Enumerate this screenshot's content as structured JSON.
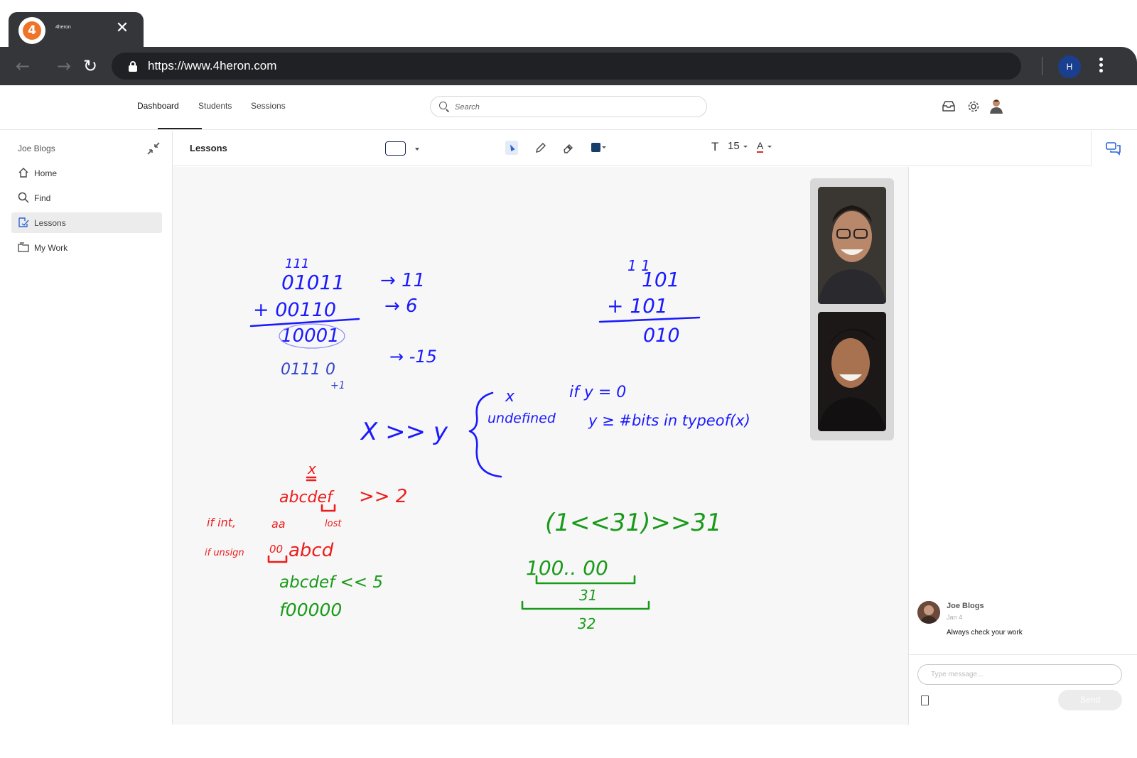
{
  "browser": {
    "tab_title": "4heron",
    "tab_close": "✕",
    "url": "https://www.4heron.com",
    "profile_initial": "H",
    "favicon_letter": "4"
  },
  "header": {
    "tabs": [
      {
        "label": "Dashboard",
        "active": true
      },
      {
        "label": "Students",
        "active": false
      },
      {
        "label": "Sessions",
        "active": false
      }
    ],
    "search_placeholder": "Search"
  },
  "sidebar": {
    "user_name": "Joe Blogs",
    "items": [
      {
        "label": "Home",
        "icon": "home-icon",
        "active": false
      },
      {
        "label": "Find",
        "icon": "search-icon",
        "active": false
      },
      {
        "label": "Lessons",
        "icon": "lessons-icon",
        "active": true
      },
      {
        "label": "My Work",
        "icon": "folder-icon",
        "active": false
      }
    ]
  },
  "toolbar": {
    "title": "Lessons",
    "text_tool": "T",
    "font_size": "15",
    "font_color_label": "A",
    "selected_color": "#173e6a"
  },
  "whiteboard": {
    "colors": {
      "blue": "#1a1aff",
      "red": "#ee1c1c",
      "green": "#1a9a1a"
    },
    "blue_notes": {
      "carry_row": "111",
      "addend1": "01011",
      "addend2": "+ 00110",
      "sum": "10001",
      "arrow_11": "→ 11",
      "arrow_6": "→ 6",
      "arrow_neg15": "→ -15",
      "inverted": "0111 0",
      "plus_one": "+1",
      "carry_right": "1 1",
      "r_addend1": "101",
      "r_addend2": "+ 101",
      "r_sum": "010",
      "shift_expr": "X >> y",
      "case1_value": "x",
      "case1_cond": "if y = 0",
      "case2_value": "undefined",
      "case2_cond": "y ≥ #bits in typeof(x)"
    },
    "red_notes": {
      "x_mark": "x",
      "expr": "abcdef",
      "op": ">>  2",
      "if_int": "if int,",
      "aa": "aa",
      "lost": "lost",
      "if_unsigned": "if unsign",
      "zeros": "00",
      "result": "abcd"
    },
    "green_notes": {
      "left_shift": "abcdef  << 5",
      "left_result": "f00000",
      "shift_expr": "(1<<31)>>31",
      "bits": "100..  00",
      "count31": "31",
      "count32": "32"
    }
  },
  "chat": {
    "messages": [
      {
        "author": "Joe Blogs",
        "date": "Jan 4",
        "text": "Always check your work"
      }
    ],
    "input_placeholder": "Type message...",
    "send_label": "Send"
  }
}
